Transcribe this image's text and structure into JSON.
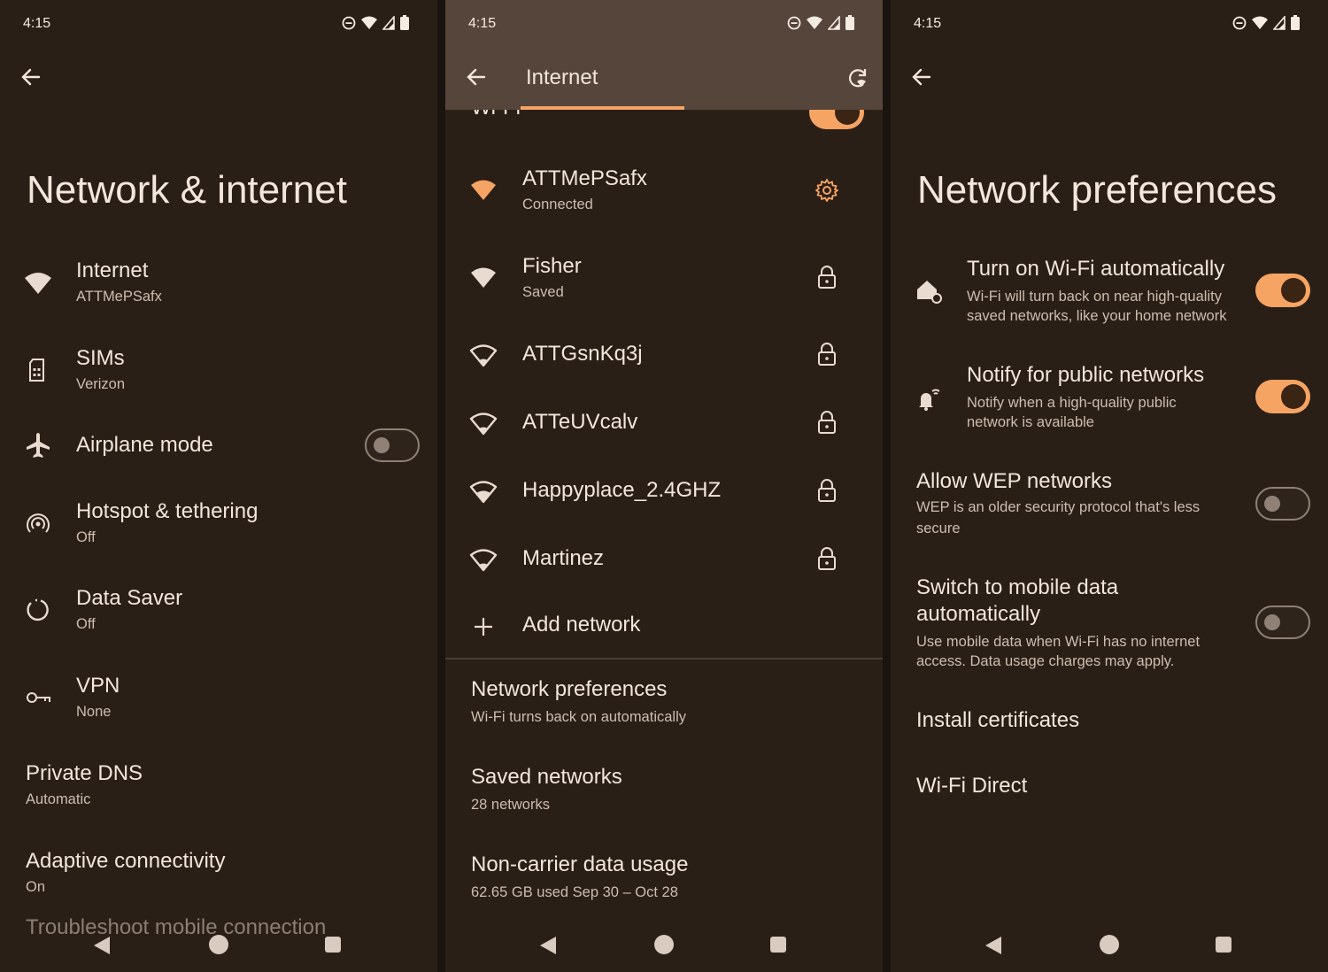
{
  "status": {
    "time": "4:15"
  },
  "screen1": {
    "title": "Network & internet",
    "items": [
      {
        "title": "Internet",
        "subtitle": "ATTMePSafx"
      },
      {
        "title": "SIMs",
        "subtitle": "Verizon"
      },
      {
        "title": "Airplane mode"
      },
      {
        "title": "Hotspot & tethering",
        "subtitle": "Off"
      },
      {
        "title": "Data Saver",
        "subtitle": "Off"
      },
      {
        "title": "VPN",
        "subtitle": "None"
      },
      {
        "title": "Private DNS",
        "subtitle": "Automatic"
      },
      {
        "title": "Adaptive connectivity",
        "subtitle": "On"
      },
      {
        "title": "Troubleshoot mobile connection"
      }
    ],
    "airplane_mode_on": false
  },
  "screen2": {
    "title": "Internet",
    "wifi_label": "Wi-Fi",
    "wifi_on": true,
    "networks": [
      {
        "name": "ATTMePSafx",
        "status": "Connected"
      },
      {
        "name": "Fisher",
        "status": "Saved"
      },
      {
        "name": "ATTGsnKq3j"
      },
      {
        "name": "ATTeUVcalv"
      },
      {
        "name": "Happyplace_2.4GHZ"
      },
      {
        "name": "Martinez"
      }
    ],
    "add_network": "Add network",
    "prefs": [
      {
        "title": "Network preferences",
        "subtitle": "Wi-Fi turns back on automatically"
      },
      {
        "title": "Saved networks",
        "subtitle": "28 networks"
      },
      {
        "title": "Non-carrier data usage",
        "subtitle": "62.65 GB used Sep 30 – Oct 28"
      }
    ]
  },
  "screen3": {
    "title": "Network preferences",
    "items": [
      {
        "title": "Turn on Wi-Fi automatically",
        "subtitle1": "Wi-Fi will turn back on near high-quality",
        "subtitle2": "saved networks, like your home network",
        "on": true
      },
      {
        "title": "Notify for public networks",
        "subtitle1": "Notify when a high-quality public",
        "subtitle2": "network is available",
        "on": true
      },
      {
        "title": "Allow WEP networks",
        "subtitle1": "WEP is an older security protocol that's less",
        "subtitle2": "secure",
        "on": false
      },
      {
        "title1": "Switch to mobile data",
        "title2": "automatically",
        "subtitle1": "Use mobile data when Wi-Fi has no internet",
        "subtitle2": "access. Data usage charges may apply.",
        "on": false
      },
      {
        "title": "Install certificates"
      },
      {
        "title": "Wi-Fi Direct"
      }
    ]
  },
  "colors": {
    "accent": "#f6a463",
    "background": "#2a1f17",
    "appbar": "#56453a"
  }
}
